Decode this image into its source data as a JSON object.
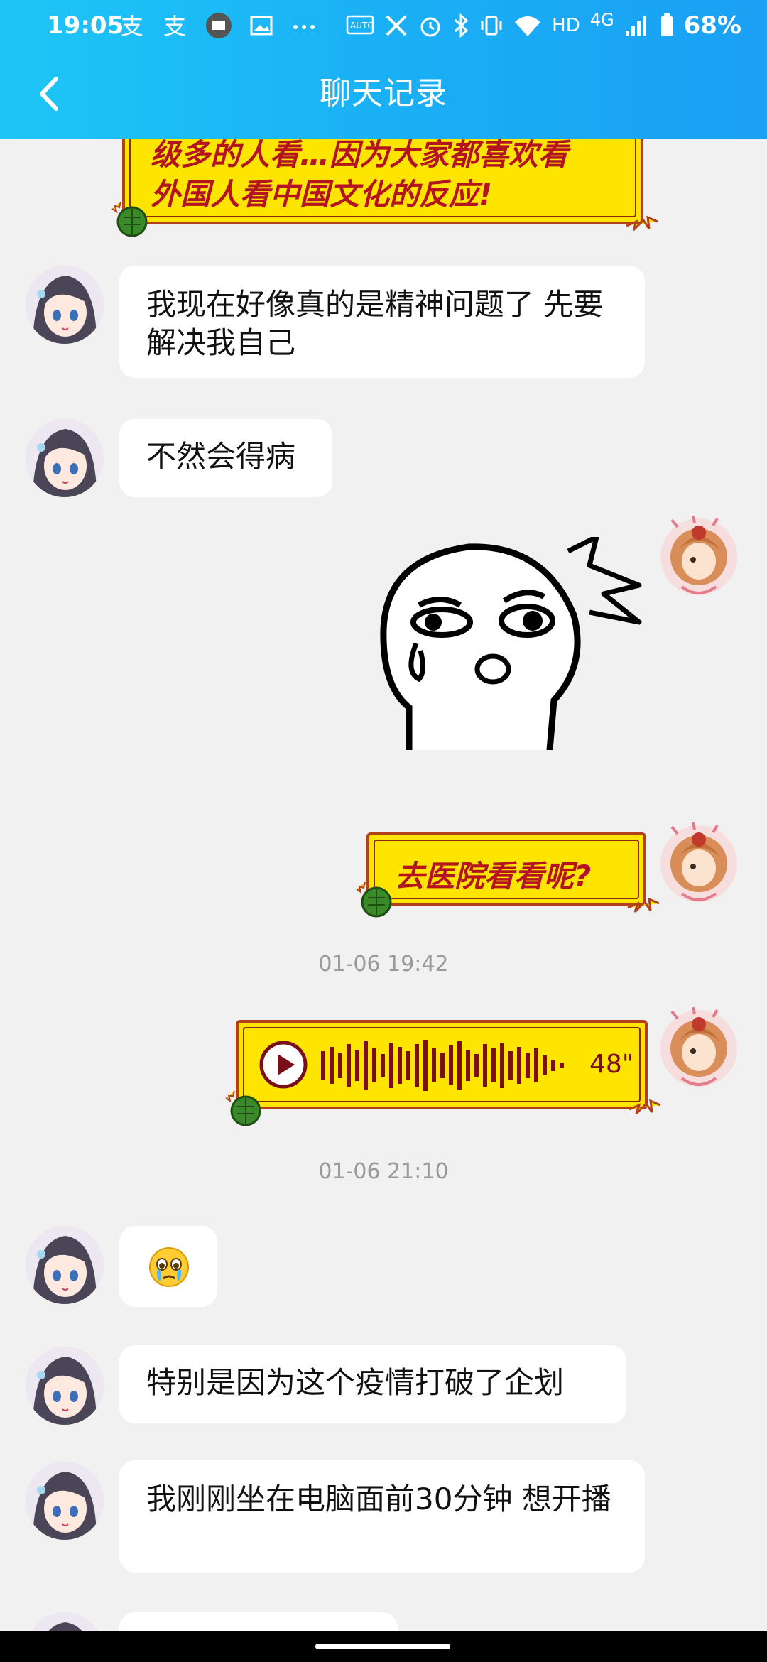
{
  "status_bar": {
    "time": "19:05",
    "network": "4G",
    "hd": "HD",
    "battery": "68%"
  },
  "header": {
    "title": "聊天记录"
  },
  "messages": {
    "top_partial_line1": "级多的人看…因为大家都喜欢看",
    "top_partial_line2": "外国人看中国文化的反应!",
    "m1": "我现在好像真的是精神问题了 先要解决我自己",
    "m2": "不然会得病",
    "m3": "去医院看看呢?",
    "ts1": "01-06 19:42",
    "voice_duration": "48\"",
    "ts2": "01-06 21:10",
    "m4_emoji": "😢",
    "m5": "特别是因为这个疫情打破了企划",
    "m6": "我刚刚坐在电脑面前30分钟 想开播"
  },
  "colors": {
    "header_start": "#1ec6f6",
    "header_end": "#1aa0f4",
    "bubble_yellow": "#fde500",
    "bubble_red_text": "#b3141f",
    "background": "#f1f1f1"
  }
}
